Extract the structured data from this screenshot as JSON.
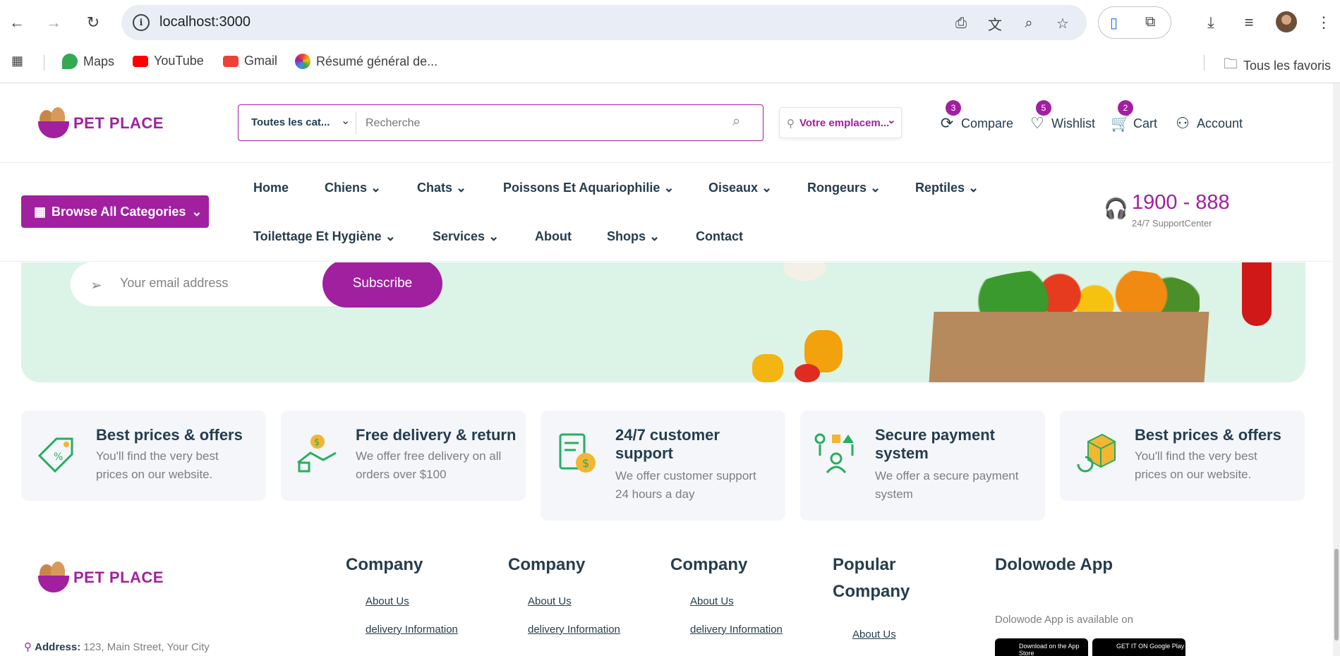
{
  "browser": {
    "url": "localhost:3000",
    "bookmarks": [
      {
        "label": "Maps",
        "color": "#34a853"
      },
      {
        "label": "YouTube",
        "color": "#ff0000"
      },
      {
        "label": "Gmail",
        "color": "#ea4335"
      },
      {
        "label": "Résumé général de...",
        "color": "#fbbc05"
      }
    ],
    "all_bookmarks": "Tous les favoris"
  },
  "header": {
    "logo_text": "PET PLACE",
    "search_category": "Toutes les cat...",
    "search_placeholder": "Recherche",
    "location": "Votre emplacem...",
    "actions": [
      {
        "label": "Compare",
        "badge": "3",
        "icon": "compare-icon"
      },
      {
        "label": "Wishlist",
        "badge": "5",
        "icon": "heart-icon"
      },
      {
        "label": "Cart",
        "badge": "2",
        "icon": "cart-icon"
      },
      {
        "label": "Account",
        "badge": "",
        "icon": "user-icon"
      }
    ]
  },
  "nav": {
    "browse": "Browse All Categories",
    "links": [
      "Home",
      "Chiens",
      "Chats",
      "Poissons Et Aquariophilie",
      "Oiseaux",
      "Rongeurs",
      "Reptiles",
      "Toilettage Et Hygiène",
      "Services",
      "About",
      "Shops",
      "Contact"
    ],
    "phone": "1900 - 888",
    "support": "24/7 SupportCenter"
  },
  "newsletter": {
    "placeholder": "Your email address",
    "button": "Subscribe"
  },
  "features": [
    {
      "title": "Best prices & offers",
      "desc": "You'll find the very best prices on our website.",
      "icon": "price-tag-icon"
    },
    {
      "title": "Free delivery & return",
      "desc": "We offer free delivery on all orders over $100",
      "icon": "delivery-hand-icon"
    },
    {
      "title": "24/7 customer support",
      "desc": "We offer customer support 24 hours a day",
      "icon": "invoice-dollar-icon"
    },
    {
      "title": "Secure payment system",
      "desc": "We offer a secure payment system",
      "icon": "payment-network-icon"
    },
    {
      "title": "Best prices & offers",
      "desc": "You'll find the very best prices on our website.",
      "icon": "return-box-icon"
    }
  ],
  "footer": {
    "logo_text": "PET PLACE",
    "address_label": "Address:",
    "address": "123, Main Street, Your City",
    "columns": [
      {
        "title": "Company",
        "links": [
          "About Us",
          "delivery Information"
        ]
      },
      {
        "title": "Company",
        "links": [
          "About Us",
          "delivery Information"
        ]
      },
      {
        "title": "Company",
        "links": [
          "About Us",
          "delivery Information"
        ]
      },
      {
        "title": "Popular Company",
        "links": [
          "About Us"
        ]
      }
    ],
    "app_title": "Dolowode App",
    "app_text": "Dolowode App is available on",
    "app_store": "Download on the App Store",
    "google_play": "GET IT ON Google Play"
  },
  "colors": {
    "brand": "#a020a0",
    "banner": "#dcf3e7",
    "feature_bg": "#f4f6fa"
  }
}
